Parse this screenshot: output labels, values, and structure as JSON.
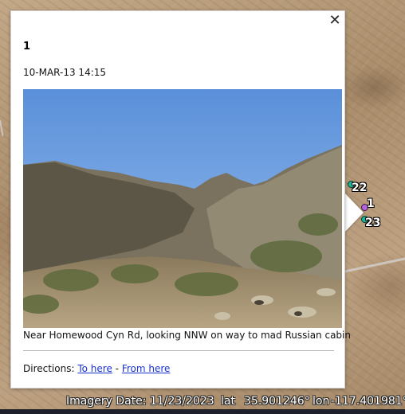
{
  "balloon": {
    "title": "1",
    "timestamp": "10-MAR-13 14:15",
    "caption": "Near Homewood Cyn Rd, looking NNW on way to mad Russian cabin",
    "close_icon": "close-icon",
    "directions_label": "Directions:",
    "to_here": "To here",
    "separator": "-",
    "from_here": "From here"
  },
  "markers": [
    {
      "label": "22",
      "color": "#1fb59a"
    },
    {
      "label": "1",
      "color": "#b266d9"
    },
    {
      "label": "23",
      "color": "#1fb59a"
    }
  ],
  "status": {
    "imagery_date": "Imagery Date: 11/23/2023",
    "lat_label": "lat",
    "lat_value": "35.901246°",
    "lon_label": "lon",
    "lon_value": "-117.401981°"
  }
}
